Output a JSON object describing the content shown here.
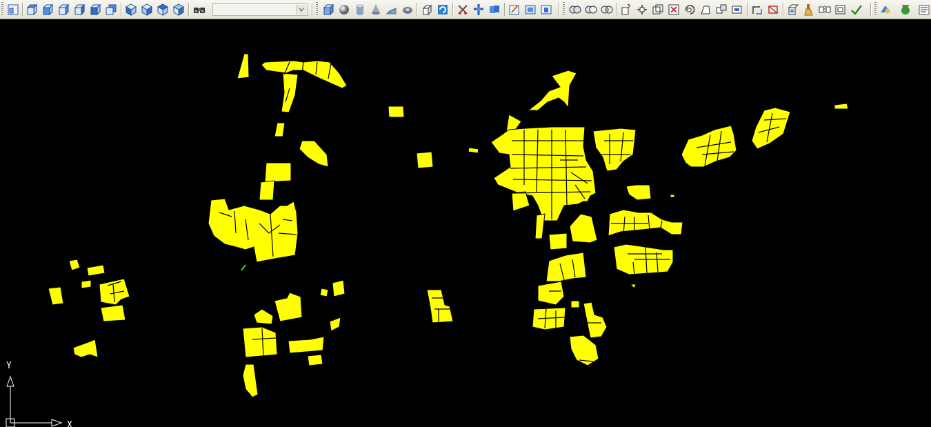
{
  "app": {
    "layer_combo_value": "",
    "toolbar_icons": [
      "new-viewport-icon",
      "top-view-icon",
      "bottom-view-icon",
      "left-view-icon",
      "right-view-icon",
      "front-view-icon",
      "back-view-icon",
      "sw-isometric-icon",
      "se-isometric-icon",
      "ne-isometric-icon",
      "nw-isometric-icon",
      "named-views-icon",
      "box-icon",
      "sphere-icon",
      "cylinder-icon",
      "cone-icon",
      "wedge-icon",
      "torus-icon",
      "extrude-icon",
      "revolve-icon",
      "slice-icon",
      "section-icon",
      "interfere-icon",
      "setup-drawing-icon",
      "setup-view-icon",
      "setup-profile-icon",
      "union-icon",
      "subtract-icon",
      "intersect-icon",
      "extrude-faces-icon",
      "move-faces-icon",
      "offset-faces-icon",
      "delete-faces-icon",
      "rotate-faces-icon",
      "taper-faces-icon",
      "copy-faces-icon",
      "color-faces-icon",
      "copy-edges-icon",
      "color-edges-icon",
      "imprint-icon",
      "clean-icon",
      "separate-icon",
      "shell-icon",
      "check-icon",
      "render-icon",
      "materials-icon",
      "landscape-icon"
    ]
  },
  "drawing": {
    "background_color": "#000000",
    "hatch_color": "#ffff00",
    "ucs_icon": {
      "y_label": "Y",
      "x_label": "X"
    }
  }
}
